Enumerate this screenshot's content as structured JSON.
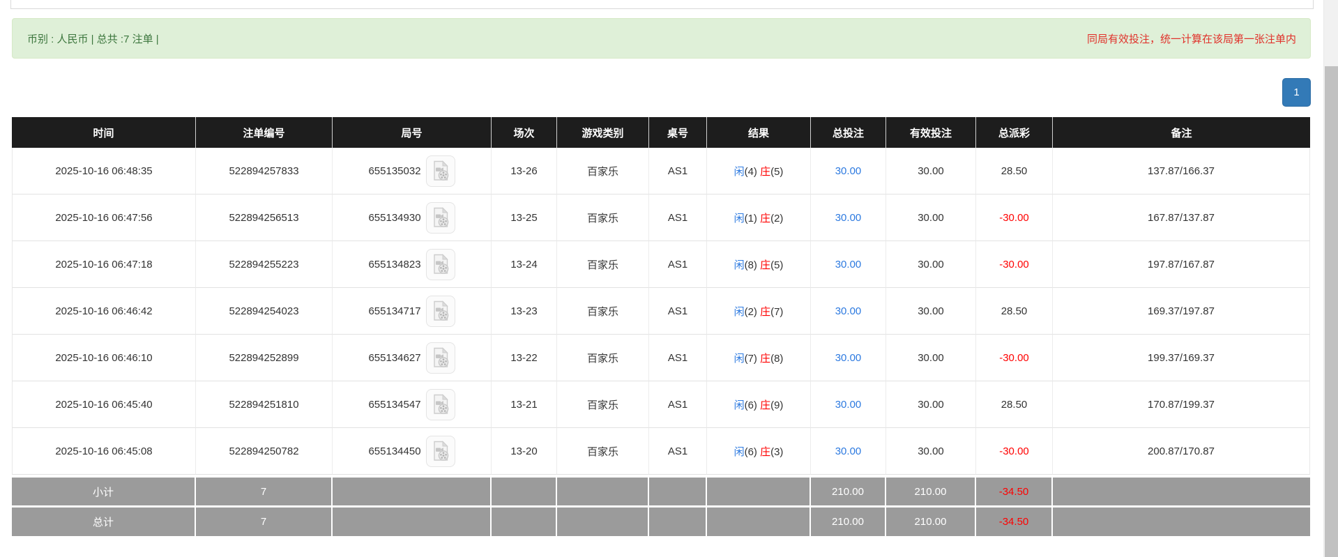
{
  "banner": {
    "left_text": "币别 : 人民币 | 总共 :7 注单 |",
    "right_text": "同局有效投注，统一计算在该局第一张注单内"
  },
  "pagination": {
    "current_page": "1"
  },
  "icons": {
    "round_video_icon": "video-replay-icon"
  },
  "table": {
    "headers": [
      "时间",
      "注单编号",
      "局号",
      "场次",
      "游戏类别",
      "桌号",
      "结果",
      "总投注",
      "有效投注",
      "总派彩",
      "备注"
    ],
    "rows": [
      {
        "time": "2025-10-16 06:48:35",
        "bet_id": "522894257833",
        "round_id": "655135032",
        "session": "13-26",
        "game_type": "百家乐",
        "table_no": "AS1",
        "result": {
          "player_label": "闲",
          "player_score": "(4)",
          "banker_label": "庄",
          "banker_score": "(5)"
        },
        "total_bet": "30.00",
        "valid_bet": "30.00",
        "payout": "28.50",
        "remark": "137.87/166.37"
      },
      {
        "time": "2025-10-16 06:47:56",
        "bet_id": "522894256513",
        "round_id": "655134930",
        "session": "13-25",
        "game_type": "百家乐",
        "table_no": "AS1",
        "result": {
          "player_label": "闲",
          "player_score": "(1)",
          "banker_label": "庄",
          "banker_score": "(2)"
        },
        "total_bet": "30.00",
        "valid_bet": "30.00",
        "payout": "-30.00",
        "remark": "167.87/137.87"
      },
      {
        "time": "2025-10-16 06:47:18",
        "bet_id": "522894255223",
        "round_id": "655134823",
        "session": "13-24",
        "game_type": "百家乐",
        "table_no": "AS1",
        "result": {
          "player_label": "闲",
          "player_score": "(8)",
          "banker_label": "庄",
          "banker_score": "(5)"
        },
        "total_bet": "30.00",
        "valid_bet": "30.00",
        "payout": "-30.00",
        "remark": "197.87/167.87"
      },
      {
        "time": "2025-10-16 06:46:42",
        "bet_id": "522894254023",
        "round_id": "655134717",
        "session": "13-23",
        "game_type": "百家乐",
        "table_no": "AS1",
        "result": {
          "player_label": "闲",
          "player_score": "(2)",
          "banker_label": "庄",
          "banker_score": "(7)"
        },
        "total_bet": "30.00",
        "valid_bet": "30.00",
        "payout": "28.50",
        "remark": "169.37/197.87"
      },
      {
        "time": "2025-10-16 06:46:10",
        "bet_id": "522894252899",
        "round_id": "655134627",
        "session": "13-22",
        "game_type": "百家乐",
        "table_no": "AS1",
        "result": {
          "player_label": "闲",
          "player_score": "(7)",
          "banker_label": "庄",
          "banker_score": "(8)"
        },
        "total_bet": "30.00",
        "valid_bet": "30.00",
        "payout": "-30.00",
        "remark": "199.37/169.37"
      },
      {
        "time": "2025-10-16 06:45:40",
        "bet_id": "522894251810",
        "round_id": "655134547",
        "session": "13-21",
        "game_type": "百家乐",
        "table_no": "AS1",
        "result": {
          "player_label": "闲",
          "player_score": "(6)",
          "banker_label": "庄",
          "banker_score": "(9)"
        },
        "total_bet": "30.00",
        "valid_bet": "30.00",
        "payout": "28.50",
        "remark": "170.87/199.37"
      },
      {
        "time": "2025-10-16 06:45:08",
        "bet_id": "522894250782",
        "round_id": "655134450",
        "session": "13-20",
        "game_type": "百家乐",
        "table_no": "AS1",
        "result": {
          "player_label": "闲",
          "player_score": "(6)",
          "banker_label": "庄",
          "banker_score": "(3)"
        },
        "total_bet": "30.00",
        "valid_bet": "30.00",
        "payout": "-30.00",
        "remark": "200.87/170.87"
      }
    ],
    "subtotal": {
      "label": "小计",
      "count": "7",
      "total_bet": "210.00",
      "valid_bet": "210.00",
      "payout": "-34.50"
    },
    "total": {
      "label": "总计",
      "count": "7",
      "total_bet": "210.00",
      "valid_bet": "210.00",
      "payout": "-34.50"
    }
  },
  "colors": {
    "green_bg": "#dff0d8",
    "green_border": "#d6e9c6",
    "green_text": "#3c763d",
    "banner_red": "#e0322b",
    "link_blue": "#2d7ae0",
    "neg_red": "#ff0000",
    "pagination_blue": "#337ab7",
    "header_bg": "#1d1d1d",
    "footer_gray": "#9b9b9b"
  }
}
